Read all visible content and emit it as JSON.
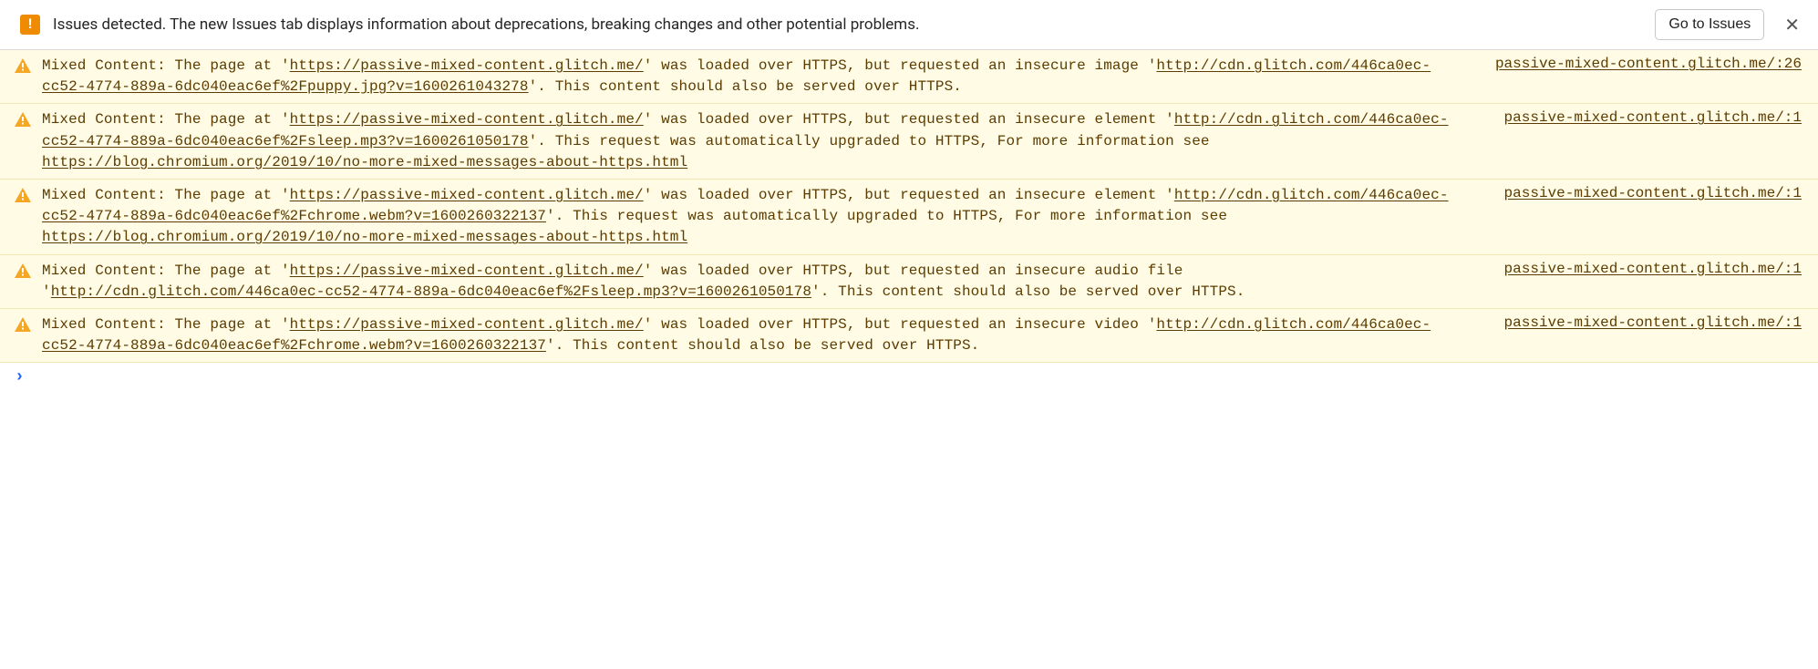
{
  "banner": {
    "text": "Issues detected. The new Issues tab displays information about deprecations, breaking changes and other potential problems.",
    "button_label": "Go to Issues",
    "close_label": "✕"
  },
  "warnings": [
    {
      "pre": "Mixed Content: The page at '",
      "link1": "https://passive-mixed-content.glitch.me/",
      "mid1": "' was loaded over HTTPS, but requested an insecure image '",
      "link2": "http://cdn.glitch.com/446ca0ec-cc52-4774-889a-6dc040eac6ef%2Fpuppy.jpg?v=1600261043278",
      "mid2": "'. This content should also be served over HTTPS.",
      "link3": "",
      "post": "",
      "source": "passive-mixed-content.glitch.me/:26"
    },
    {
      "pre": "Mixed Content: The page at '",
      "link1": "https://passive-mixed-content.glitch.me/",
      "mid1": "' was loaded over HTTPS, but requested an insecure element '",
      "link2": "http://cdn.glitch.com/446ca0ec-cc52-4774-889a-6dc040eac6ef%2Fsleep.mp3?v=1600261050178",
      "mid2": "'. This request was automatically upgraded to HTTPS, For more information see ",
      "link3": "https://blog.chromium.org/2019/10/no-more-mixed-messages-about-https.html",
      "post": "",
      "source": "passive-mixed-content.glitch.me/:1"
    },
    {
      "pre": "Mixed Content: The page at '",
      "link1": "https://passive-mixed-content.glitch.me/",
      "mid1": "' was loaded over HTTPS, but requested an insecure element '",
      "link2": "http://cdn.glitch.com/446ca0ec-cc52-4774-889a-6dc040eac6ef%2Fchrome.webm?v=1600260322137",
      "mid2": "'. This request was automatically upgraded to HTTPS, For more information see ",
      "link3": "https://blog.chromium.org/2019/10/no-more-mixed-messages-about-https.html",
      "post": "",
      "source": "passive-mixed-content.glitch.me/:1"
    },
    {
      "pre": "Mixed Content: The page at '",
      "link1": "https://passive-mixed-content.glitch.me/",
      "mid1": "' was loaded over HTTPS, but requested an insecure audio file '",
      "link2": "http://cdn.glitch.com/446ca0ec-cc52-4774-889a-6dc040eac6ef%2Fsleep.mp3?v=1600261050178",
      "mid2": "'. This content should also be served over HTTPS.",
      "link3": "",
      "post": "",
      "source": "passive-mixed-content.glitch.me/:1"
    },
    {
      "pre": "Mixed Content: The page at '",
      "link1": "https://passive-mixed-content.glitch.me/",
      "mid1": "' was loaded over HTTPS, but requested an insecure video '",
      "link2": "http://cdn.glitch.com/446ca0ec-cc52-4774-889a-6dc040eac6ef%2Fchrome.webm?v=1600260322137",
      "mid2": "'. This content should also be served over HTTPS.",
      "link3": "",
      "post": "",
      "source": "passive-mixed-content.glitch.me/:1"
    }
  ],
  "prompt": {
    "chevron": "›"
  }
}
